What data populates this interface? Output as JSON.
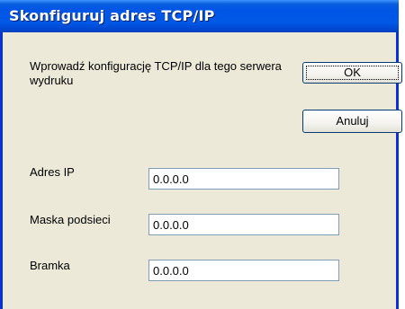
{
  "dialog": {
    "title": "Skonfiguruj adres TCP/IP",
    "instruction": "Wprowadź konfigurację TCP/IP dla tego serwera wydruku",
    "ok_label": "OK",
    "cancel_label": "Anuluj",
    "fields": [
      {
        "label": "Adres IP",
        "value": "0.0.0.0"
      },
      {
        "label": "Maska podsieci",
        "value": "0.0.0.0"
      },
      {
        "label": "Bramka",
        "value": "0.0.0.0"
      }
    ]
  },
  "colors": {
    "titlebar": "#0055e5",
    "window_face": "#ece9d8",
    "frame": "#0831d9",
    "input_border": "#7f9db9"
  }
}
